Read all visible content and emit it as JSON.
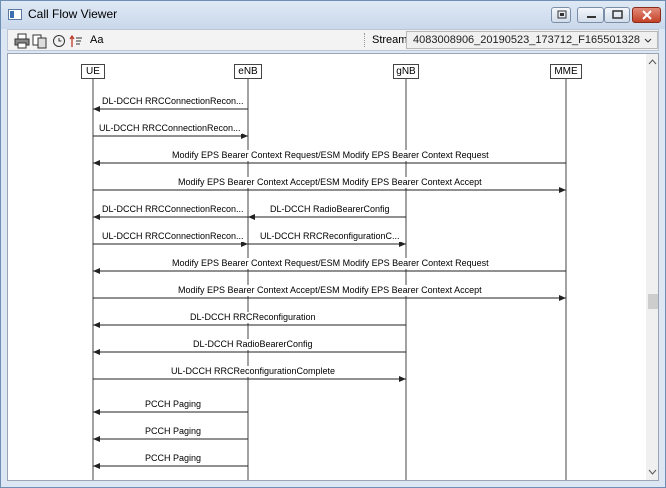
{
  "window": {
    "title": "Call Flow Viewer"
  },
  "toolbar": {
    "icons": [
      "print-icon",
      "copy-icon",
      "clock-icon",
      "sort-icon"
    ],
    "font_label": "Aa",
    "stream_label": "Stream",
    "stream_value": "4083008906_20190523_173712_F165501328."
  },
  "nodes": [
    "UE",
    "eNB",
    "gNB",
    "MME"
  ],
  "messages": [
    {
      "label": "DL-DCCH RRCConnectionRecon..."
    },
    {
      "label": "UL-DCCH RRCConnectionRecon..."
    },
    {
      "label": "Modify EPS Bearer Context Request/ESM Modify EPS Bearer Context Request"
    },
    {
      "label": "Modify EPS Bearer Context Accept/ESM Modify EPS Bearer Context Accept"
    },
    {
      "label": "DL-DCCH RRCConnectionRecon..."
    },
    {
      "label": "DL-DCCH RadioBearerConfig"
    },
    {
      "label": "UL-DCCH RRCConnectionRecon..."
    },
    {
      "label": "UL-DCCH RRCReconfigurationC..."
    },
    {
      "label": "Modify EPS Bearer Context Request/ESM Modify EPS Bearer Context Request"
    },
    {
      "label": "Modify EPS Bearer Context Accept/ESM Modify EPS Bearer Context Accept"
    },
    {
      "label": "DL-DCCH RRCReconfiguration"
    },
    {
      "label": "DL-DCCH RadioBearerConfig"
    },
    {
      "label": "UL-DCCH RRCReconfigurationComplete"
    },
    {
      "label": "PCCH Paging"
    },
    {
      "label": "PCCH Paging"
    },
    {
      "label": "PCCH Paging"
    }
  ]
}
